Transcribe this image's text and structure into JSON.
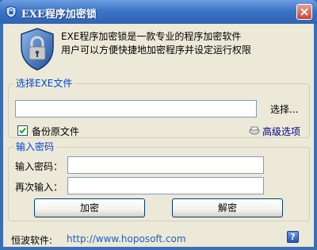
{
  "window": {
    "title": "EXE程序加密锁"
  },
  "intro": {
    "line1": "EXE程序加密锁是一款专业的程序加密软件",
    "line2": "用户可以方便快捷地加密程序并设定运行权限"
  },
  "file_group": {
    "title": "选择EXE文件",
    "file_value": "",
    "browse_label": "选择...",
    "backup_label": "备份原文件",
    "backup_checked": true,
    "advanced_label": "高级选项"
  },
  "password_group": {
    "title": "输入密码",
    "password_label": "输入密码：",
    "password_value": "",
    "confirm_label": "再次输入：",
    "confirm_value": ""
  },
  "buttons": {
    "encrypt": "加密",
    "decrypt": "解密"
  },
  "footer": {
    "company": "恒波软件:",
    "url": "http://www.hoposoft.com",
    "help": "?"
  }
}
